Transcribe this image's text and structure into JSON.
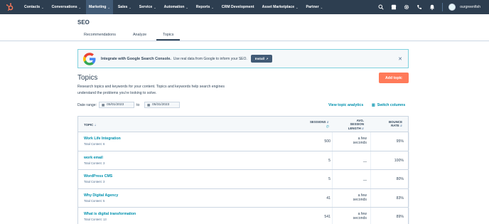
{
  "nav": {
    "items": [
      {
        "label": "Contacts"
      },
      {
        "label": "Conversations"
      },
      {
        "label": "Marketing"
      },
      {
        "label": "Sales"
      },
      {
        "label": "Service"
      },
      {
        "label": "Automation"
      },
      {
        "label": "Reports"
      },
      {
        "label": "CRM Development"
      },
      {
        "label": "Asset Marketplace"
      },
      {
        "label": "Partner"
      }
    ],
    "account_name": "ourgreenfish"
  },
  "page": {
    "title": "SEO",
    "tabs": [
      {
        "label": "Recommendations"
      },
      {
        "label": "Analyze"
      },
      {
        "label": "Topics"
      }
    ]
  },
  "banner": {
    "bold": "Integrate with Google Search Console.",
    "text": "Use real data from Google to inform your SEO.",
    "install_label": "Install"
  },
  "topics": {
    "title": "Topics",
    "add_label": "Add topic",
    "description": "Research topics and keywords for your content. Topics and keywords help search engines understand the problems you're looking to solve.",
    "date_range_label": "Date range:",
    "date_from": "05/01/2023",
    "to_label": "to",
    "date_to": "05/31/2023",
    "view_analytics": "View topic analytics",
    "switch_columns": "Switch columns"
  },
  "table": {
    "headers": {
      "topic": "TOPIC",
      "sessions": "SESSIONS",
      "avg1": "AVG.",
      "avg2": "SESSION",
      "avg3": "LENGTH",
      "bounce1": "BOUNCE",
      "bounce2": "RATE"
    },
    "rows": [
      {
        "topic": "Work Life Integration",
        "total": "Total Content: 6",
        "sessions": "500",
        "avg_a": "a few",
        "avg_b": "seconds",
        "bounce": "95%"
      },
      {
        "topic": "work email",
        "total": "Total Content: 3",
        "sessions": "5",
        "avg_a": "",
        "avg_b": "—",
        "bounce": "100%"
      },
      {
        "topic": "WordPress CMS",
        "total": "Total Content: 3",
        "sessions": "5",
        "avg_a": "",
        "avg_b": "—",
        "bounce": "80%"
      },
      {
        "topic": "Why Digital Agency",
        "total": "Total Content: 5",
        "sessions": "41",
        "avg_a": "a few",
        "avg_b": "seconds",
        "bounce": "83%"
      },
      {
        "topic": "What is digital transformation",
        "total": "Total Content: 13",
        "sessions": "541",
        "avg_a": "a few",
        "avg_b": "seconds",
        "bounce": "89%"
      }
    ]
  },
  "colors": {
    "nav_bg": "#2d3e50",
    "accent": "#ff7a59",
    "link": "#0091ae"
  }
}
